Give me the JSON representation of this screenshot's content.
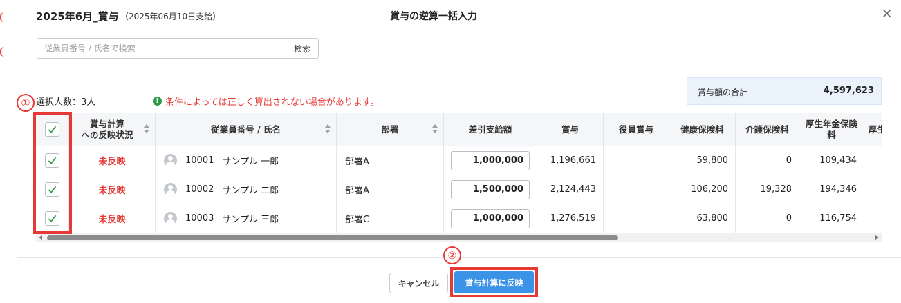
{
  "dialog": {
    "title": "2025年6月_賞与",
    "subtitle": "（2025年06月10日支給）",
    "heading": "賞与の逆算一括入力",
    "close_glyph": "×"
  },
  "search": {
    "placeholder": "従業員番号 / 氏名で検索",
    "value": "",
    "button_label": "検索"
  },
  "selection": {
    "label": "選択人数：3人"
  },
  "warning": {
    "icon": "!",
    "text": "条件によっては正しく算出されない場合があります。"
  },
  "total": {
    "label": "賞与額の合計",
    "value": "4,597,623"
  },
  "annotations": {
    "step1": "①",
    "step2": "②",
    "accent": "#e53935"
  },
  "table": {
    "headers": {
      "reflect_status": "賞与計算\nへの反映状況",
      "employee": "従業員番号 / 氏名",
      "department": "部署",
      "net_pay": "差引支給額",
      "bonus": "賞与",
      "officer_bonus": "役員賞与",
      "health_ins": "健康保険料",
      "care_ins": "介護保険料",
      "pension_ins": "厚生年金保険\n料",
      "next_col": "厚生"
    },
    "rows": [
      {
        "checked": true,
        "status": "未反映",
        "emp_no": "10001",
        "name": "サンプル 一郎",
        "department": "部署A",
        "net_pay": "1,000,000",
        "bonus": "1,196,661",
        "officer_bonus": "",
        "health_ins": "59,800",
        "care_ins": "0",
        "pension_ins": "109,434"
      },
      {
        "checked": true,
        "status": "未反映",
        "emp_no": "10002",
        "name": "サンプル 二郎",
        "department": "部署A",
        "net_pay": "1,500,000",
        "bonus": "2,124,443",
        "officer_bonus": "",
        "health_ins": "106,200",
        "care_ins": "19,328",
        "pension_ins": "194,346"
      },
      {
        "checked": true,
        "status": "未反映",
        "emp_no": "10003",
        "name": "サンプル 三郎",
        "department": "部署C",
        "net_pay": "1,000,000",
        "bonus": "1,276,519",
        "officer_bonus": "",
        "health_ins": "63,800",
        "care_ins": "0",
        "pension_ins": "116,754"
      }
    ]
  },
  "footer": {
    "cancel_label": "キャンセル",
    "apply_label": "賞与計算に反映"
  },
  "colors": {
    "primary": "#3b93e8",
    "status_red": "#e53935",
    "check_green": "#2e9b47"
  }
}
